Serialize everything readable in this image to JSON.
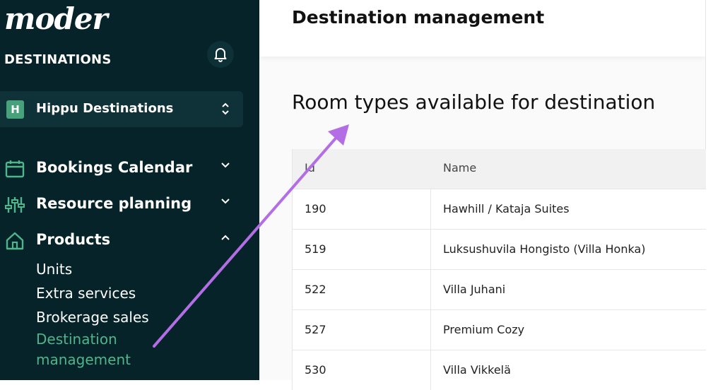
{
  "brand": {
    "logo": "moder",
    "subtitle": "DESTINATIONS"
  },
  "org": {
    "badge": "H",
    "name": "Hippu Destinations"
  },
  "nav": {
    "bookings": "Bookings Calendar",
    "resources": "Resource planning",
    "products": "Products",
    "sub": [
      "Units",
      "Extra services",
      "Brokerage sales",
      "Destination",
      "management"
    ]
  },
  "header": {
    "title": "Destination management"
  },
  "section": {
    "title": "Room types available for destination"
  },
  "table": {
    "headers": [
      "Id",
      "Name"
    ],
    "rows": [
      {
        "id": "190",
        "name": "Hawhill / Kataja Suites"
      },
      {
        "id": "519",
        "name": "Luksushuvila Hongisto (Villa Honka)"
      },
      {
        "id": "522",
        "name": "Villa Juhani"
      },
      {
        "id": "527",
        "name": "Premium Cozy"
      },
      {
        "id": "530",
        "name": "Villa Vikkelä"
      }
    ]
  },
  "colors": {
    "sidebar": "#052329",
    "accent": "#4fb58b",
    "arrow": "#b36ee6"
  },
  "icons": [
    "bell-icon",
    "updown-chevron-icon",
    "calendar-icon",
    "sliders-icon",
    "home-icon",
    "chevron-down-icon",
    "chevron-up-icon"
  ]
}
